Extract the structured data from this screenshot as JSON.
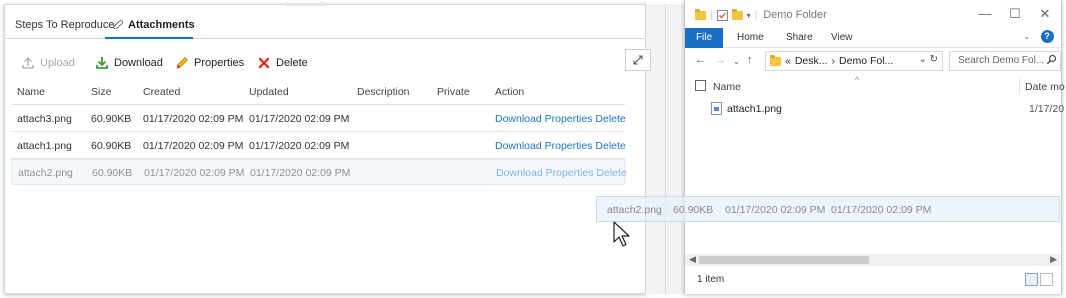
{
  "web": {
    "tabs": [
      {
        "label": "Steps To Reproduce"
      },
      {
        "label": "Attachments"
      }
    ],
    "toolbar": {
      "upload": "Upload",
      "download": "Download",
      "properties": "Properties",
      "delete": "Delete"
    },
    "grid": {
      "headers": [
        "Name",
        "Size",
        "Created",
        "Updated",
        "Description",
        "Private",
        "Action"
      ],
      "rows": [
        {
          "name": "attach3.png",
          "size": "60.90KB",
          "created": "01/17/2020 02:09 PM",
          "updated": "01/17/2020 02:09 PM",
          "description": "",
          "private": "",
          "actions": [
            "Download",
            "Properties",
            "Delete"
          ]
        },
        {
          "name": "attach1.png",
          "size": "60.90KB",
          "created": "01/17/2020 02:09 PM",
          "updated": "01/17/2020 02:09 PM",
          "description": "",
          "private": "",
          "actions": [
            "Download",
            "Properties",
            "Delete"
          ]
        },
        {
          "name": "attach2.png",
          "size": "60.90KB",
          "created": "01/17/2020 02:09 PM",
          "updated": "01/17/2020 02:09 PM",
          "description": "",
          "private": "",
          "actions": [
            "Download",
            "Properties",
            "Delete"
          ]
        }
      ]
    }
  },
  "drag": {
    "name": "attach2.png",
    "size": "60.90KB",
    "created": "01/17/2020 02:09 PM",
    "updated": "01/17/2020 02:09 PM"
  },
  "explorer": {
    "title": "Demo Folder",
    "ribbon": {
      "file": "File",
      "home": "Home",
      "share": "Share",
      "view": "View"
    },
    "address": {
      "prefix": "«",
      "part1": "Desk...",
      "sep": "›",
      "part2": "Demo Fol..."
    },
    "search_placeholder": "Search Demo Fol...",
    "columns": {
      "name": "Name",
      "date": "Date mo"
    },
    "files": [
      {
        "name": "attach1.png",
        "date": "1/17/20"
      }
    ],
    "status": "1 item"
  },
  "colors": {
    "accent": "#0078d4",
    "link": "#1a73c8",
    "file_tab": "#1a6fc4",
    "delete_red": "#e0312b",
    "download_green": "#3a9a3a",
    "properties_yellow": "#f0b429"
  }
}
